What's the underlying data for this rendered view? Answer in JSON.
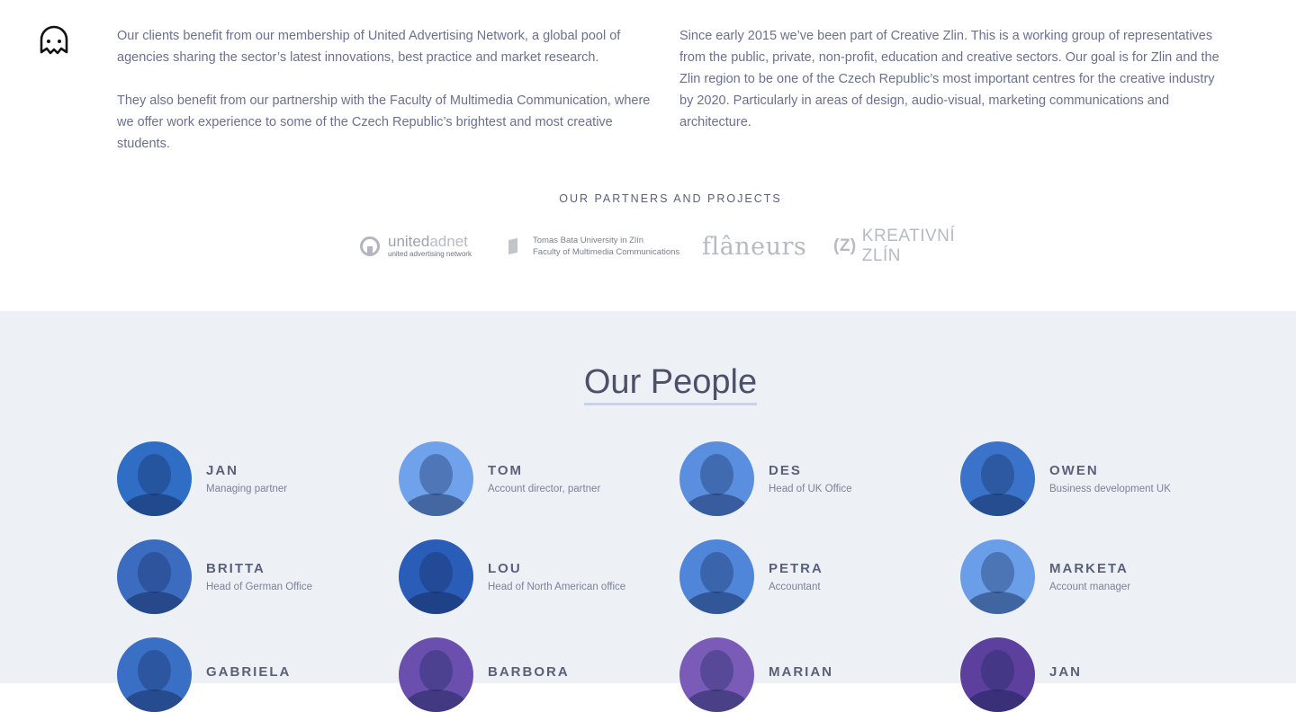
{
  "intro": {
    "left": [
      "Our clients benefit from our membership of United Advertising Network, a global pool of agencies sharing the sector’s latest innovations, best practice and market research.",
      "They also benefit from our partnership with the Faculty of Multimedia Communication, where we offer work experience to some of the Czech Republic’s brightest and most creative students."
    ],
    "right": "Since early 2015 we’ve been part of Creative Zlin. This is a working group of representatives from the public, private, non-profit, education and creative sectors. Our goal is for Zlin and the Zlin region to be one of the Czech Republic’s most important centres for the creative industry by 2020. Particularly in areas of design, audio-visual, marketing communications and architecture."
  },
  "partners": {
    "title": "OUR PARTNERS AND PROJECTS",
    "uan_name_a": "united",
    "uan_name_b": "adnet",
    "uan_sub": "united advertising network",
    "tbu_line1": "Tomas Bata University in Zlín",
    "tbu_line2": "Faculty of Multimedia Communications",
    "flaneurs": "flâneurs",
    "kz_mark": "(Z)",
    "kz_text": "KREATIVNÍ ZLÍN"
  },
  "people": {
    "title": "Our People",
    "members": [
      {
        "name": "JAN",
        "role": "Managing partner",
        "bg": "#2f6ec4"
      },
      {
        "name": "TOM",
        "role": "Account director, partner",
        "bg": "#6fa2ea"
      },
      {
        "name": "DES",
        "role": "Head of UK Office",
        "bg": "#5a8fe0"
      },
      {
        "name": "OWEN",
        "role": "Business development UK",
        "bg": "#3a73c9"
      },
      {
        "name": "BRITTA",
        "role": "Head of German Office",
        "bg": "#3b6cc0"
      },
      {
        "name": "LOU",
        "role": "Head of North American office",
        "bg": "#2a5db8"
      },
      {
        "name": "PETRA",
        "role": "Accountant",
        "bg": "#4f86d9"
      },
      {
        "name": "MARKETA",
        "role": "Account manager",
        "bg": "#6a9ee8"
      },
      {
        "name": "GABRIELA",
        "role": "",
        "bg": "#3a6fc6"
      },
      {
        "name": "BARBORA",
        "role": "",
        "bg": "#6b4fae"
      },
      {
        "name": "MARIAN",
        "role": "",
        "bg": "#7b5bb8"
      },
      {
        "name": "JAN",
        "role": "",
        "bg": "#5d3f9e"
      }
    ]
  },
  "colors": {
    "section_bg": "#edf1f6",
    "title_underline": "#c9d3e8"
  }
}
